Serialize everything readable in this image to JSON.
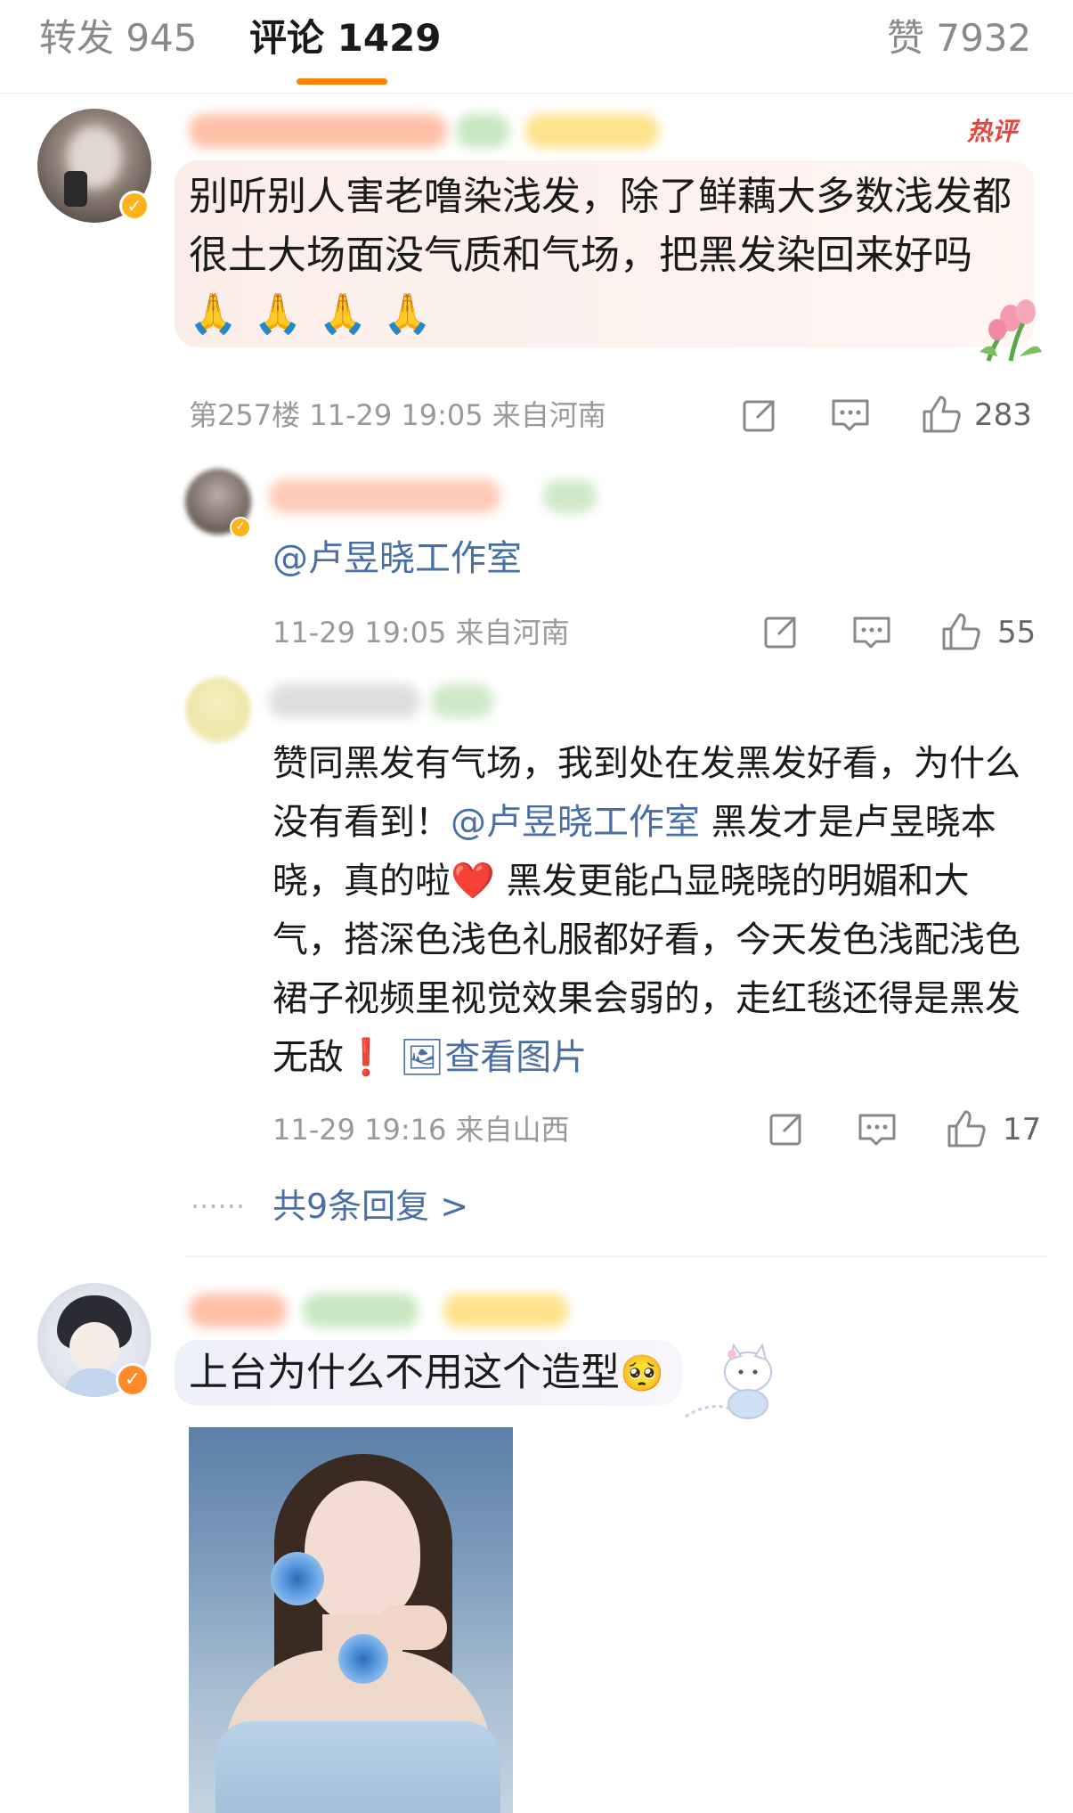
{
  "tabs": {
    "repost": "转发 945",
    "comment": "评论 1429",
    "like": "赞 7932"
  },
  "accent_color": "#ff8200",
  "link_color": "#4a6fa5",
  "comment1": {
    "hot_tag": "热评",
    "text": "别听别人害老噜染浅发，除了鲜藕大多数浅发都很土大场面没气质和气场，把黑发染回来好吗",
    "emojis": "🙏🙏🙏🙏",
    "meta": "第257楼  11-29 19:05  来自河南",
    "likes": "283"
  },
  "reply1": {
    "mention": "@卢昱晓工作室",
    "meta": "11-29 19:05  来自河南",
    "likes": "55"
  },
  "reply2": {
    "text_a": "赞同黑发有气场，我到处在发黑发好看，为什么没有看到！",
    "mention": "@卢昱晓工作室",
    "text_b": " 黑发才是卢昱晓本晓，真的啦",
    "heart": "❤️",
    "text_c": " 黑发更能凸显晓晓的明媚和大气，搭深色浅色礼服都好看，今天发色浅配浅色裙子视频里视觉效果会弱的，走红毯还得是黑发无敌",
    "exclaim": "❗",
    "view_image": "查看图片",
    "meta": "11-29 19:16  来自山西",
    "likes": "17"
  },
  "more_replies": "共9条回复 >",
  "more_dots": "······",
  "comment2": {
    "text": "上台为什么不用这个造型",
    "emoji": "🥺"
  }
}
